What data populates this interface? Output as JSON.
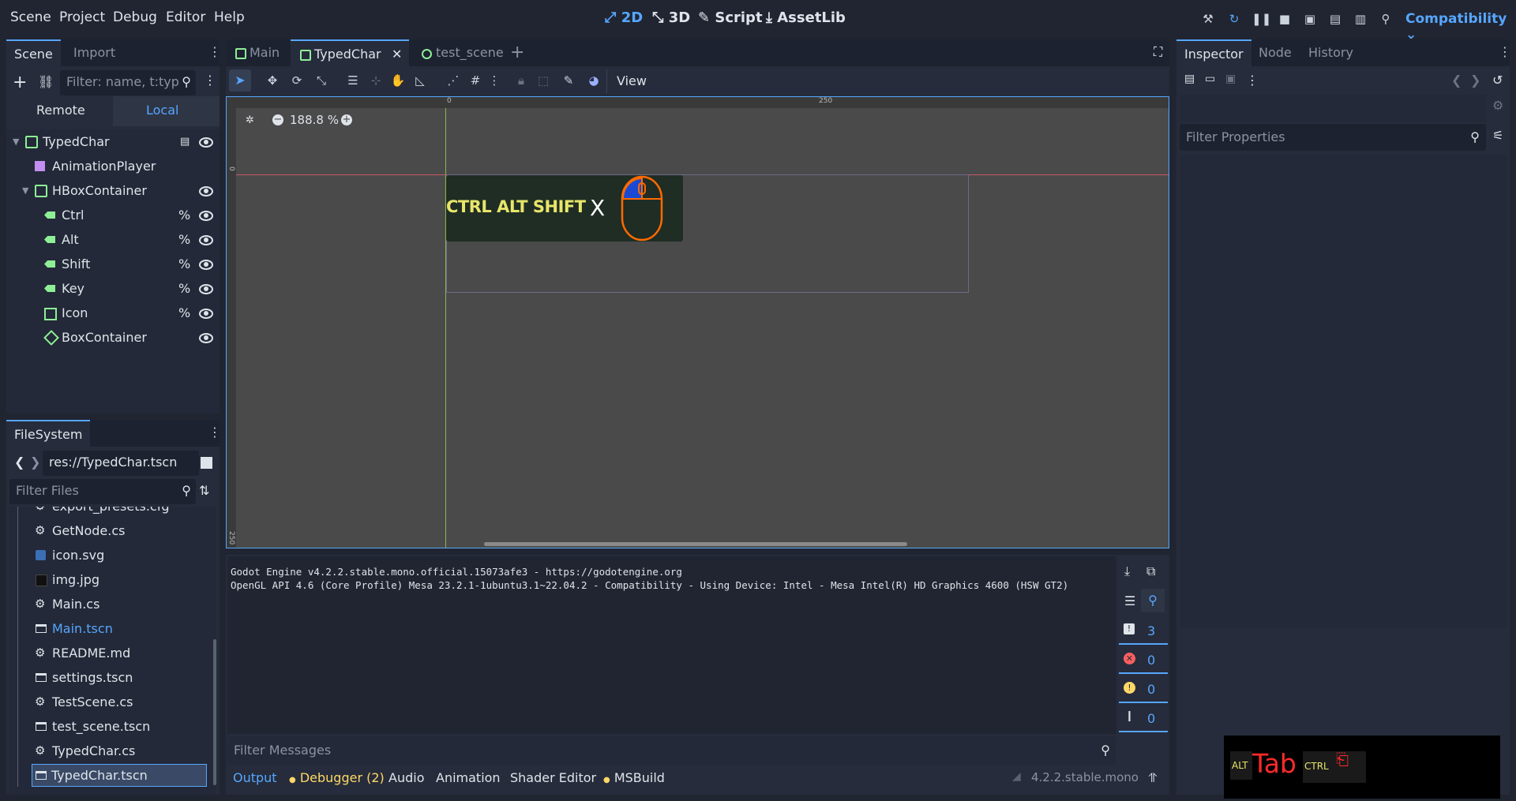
{
  "menu": [
    "Scene",
    "Project",
    "Debug",
    "Editor",
    "Help"
  ],
  "modes": {
    "twod": "2D",
    "threed": "3D",
    "script": "Script",
    "assetlib": "AssetLib"
  },
  "renderer": "Compatibility",
  "scene_dock": {
    "tabs": [
      "Scene",
      "Import"
    ],
    "filter_placeholder": "Filter: name, t:typ",
    "remote": "Remote",
    "local": "Local",
    "tree": [
      {
        "label": "TypedChar",
        "icon": "control-icon"
      },
      {
        "label": "AnimationPlayer",
        "icon": "animation-player-icon"
      },
      {
        "label": "HBoxContainer",
        "icon": "hbox-container-icon"
      },
      {
        "label": "Ctrl",
        "icon": "label-icon",
        "unique": "%"
      },
      {
        "label": "Alt",
        "icon": "label-icon",
        "unique": "%"
      },
      {
        "label": "Shift",
        "icon": "label-icon",
        "unique": "%"
      },
      {
        "label": "Key",
        "icon": "label-icon",
        "unique": "%"
      },
      {
        "label": "Icon",
        "icon": "texture-rect-icon",
        "unique": "%"
      },
      {
        "label": "BoxContainer",
        "icon": "box-container-icon"
      }
    ]
  },
  "filesystem": {
    "title": "FileSystem",
    "path": "res://TypedChar.tscn",
    "filter_placeholder": "Filter Files",
    "files": [
      {
        "name": "export_presets.cfg",
        "icon": "gear-icon"
      },
      {
        "name": "GetNode.cs",
        "icon": "gear-icon"
      },
      {
        "name": "icon.svg",
        "icon": "image-icon"
      },
      {
        "name": "img.jpg",
        "icon": "image-icon"
      },
      {
        "name": "Main.cs",
        "icon": "gear-icon"
      },
      {
        "name": "Main.tscn",
        "icon": "scene-icon"
      },
      {
        "name": "README.md",
        "icon": "gear-icon"
      },
      {
        "name": "settings.tscn",
        "icon": "scene-icon"
      },
      {
        "name": "TestScene.cs",
        "icon": "gear-icon"
      },
      {
        "name": "test_scene.tscn",
        "icon": "scene-icon"
      },
      {
        "name": "TypedChar.cs",
        "icon": "gear-icon"
      },
      {
        "name": "TypedChar.tscn",
        "icon": "scene-icon"
      }
    ]
  },
  "editor_tabs": [
    "Main",
    "TypedChar",
    "test_scene"
  ],
  "toolbar": {
    "view": "View"
  },
  "viewport": {
    "zoom": "188.8 %",
    "ruler_0": "0",
    "ruler_250": "250",
    "ruler_v_0": "0",
    "ruler_v_250": "250",
    "preview_text": "CTRL ALT SHIFT",
    "preview_key": "X"
  },
  "output": {
    "line1": "Godot Engine v4.2.2.stable.mono.official.15073afe3 - https://godotengine.org",
    "line2": "OpenGL API 4.6 (Core Profile) Mesa 23.2.1-1ubuntu3.1~22.04.2 - Compatibility - Using Device: Intel - Mesa Intel(R) HD Graphics 4600 (HSW GT2)",
    "filter_placeholder": "Filter Messages",
    "counts": {
      "messages": "3",
      "errors": "0",
      "warnings": "0",
      "editor": "0"
    }
  },
  "bottom_tabs": [
    "Output",
    "Debugger (2)",
    "Audio",
    "Animation",
    "Shader Editor",
    "MSBuild"
  ],
  "version": "4.2.2.stable.mono",
  "inspector": {
    "tabs": [
      "Inspector",
      "Node",
      "History"
    ],
    "filter_placeholder": "Filter Properties"
  },
  "overlay": {
    "alt": "ALT",
    "tab": "Tab",
    "ctrl": "CTRL"
  },
  "colors": {
    "accent": "#57a6ff",
    "node_green": "#8eef97",
    "debugger_yellow": "#ffd866"
  }
}
